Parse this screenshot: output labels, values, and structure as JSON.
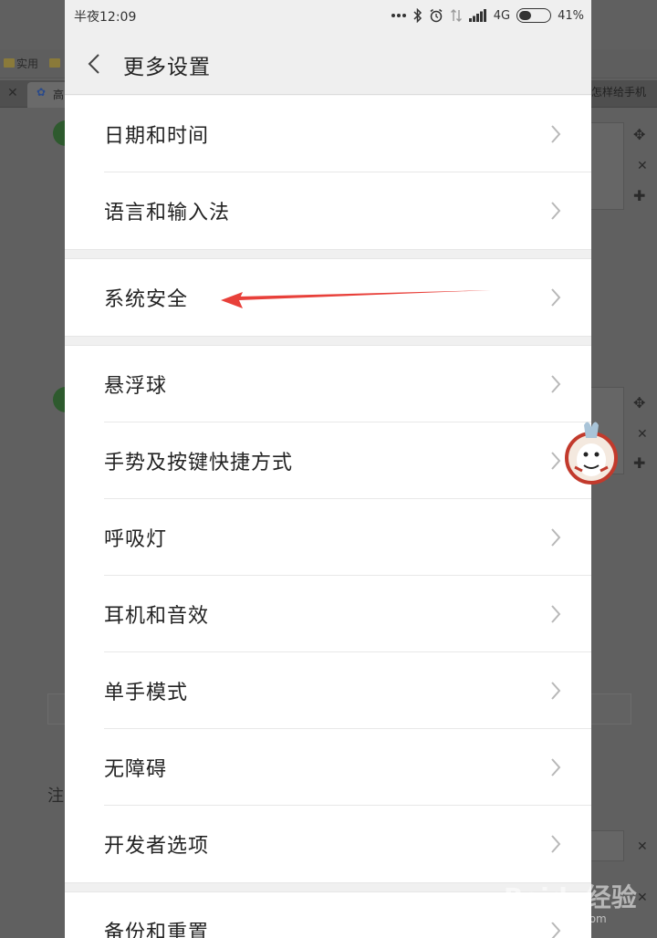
{
  "status_bar": {
    "time": "半夜12:09",
    "network": "4G",
    "battery_percent": "41%",
    "battery_level": 0.41
  },
  "header": {
    "title": "更多设置"
  },
  "groups": [
    {
      "items": [
        {
          "label": "日期和时间"
        },
        {
          "label": "语言和输入法"
        }
      ]
    },
    {
      "items": [
        {
          "label": "系统安全"
        }
      ]
    },
    {
      "items": [
        {
          "label": "悬浮球"
        },
        {
          "label": "手势及按键快捷方式"
        },
        {
          "label": "呼吸灯"
        },
        {
          "label": "耳机和音效"
        },
        {
          "label": "单手模式"
        },
        {
          "label": "无障碍"
        },
        {
          "label": "开发者选项"
        }
      ]
    },
    {
      "items": [
        {
          "label": "备份和重置"
        }
      ]
    }
  ],
  "background": {
    "bookmark_label": "实用",
    "tab_left_label": "高",
    "tab_right_label": "怎样给手机",
    "note_label": "注"
  },
  "watermark": {
    "main": "Baidu经验",
    "sub": "jingyan.baidu.com"
  },
  "colors": {
    "annotation_arrow": "#e8403a",
    "screen_background": "#f7f7f7",
    "chevron": "#b8b8b8"
  }
}
